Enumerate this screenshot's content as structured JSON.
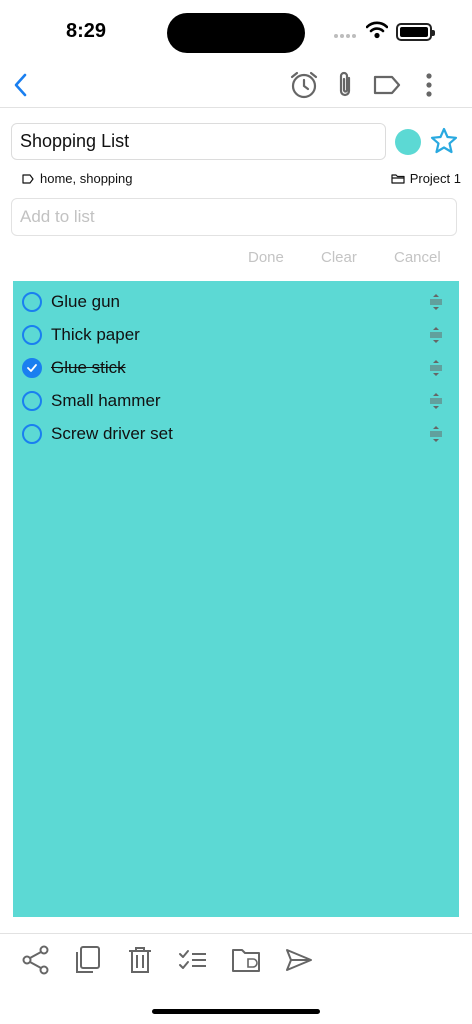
{
  "status_bar": {
    "time": "8:29"
  },
  "nav": {
    "back_icon": "chevron-left-icon",
    "actions": [
      "alarm-icon",
      "paperclip-icon",
      "tag-icon",
      "more-vertical-icon"
    ],
    "accent_color": "#1a7ff0"
  },
  "note": {
    "title": "Shopping List",
    "color": "#5cd9d4",
    "favorite": false,
    "tags": "home, shopping",
    "project": "Project 1"
  },
  "add_item": {
    "placeholder": "Add to list"
  },
  "actions": {
    "done": "Done",
    "clear": "Clear",
    "cancel": "Cancel"
  },
  "items": [
    {
      "label": "Glue gun",
      "checked": false
    },
    {
      "label": "Thick paper",
      "checked": false
    },
    {
      "label": "Glue stick",
      "checked": true
    },
    {
      "label": "Small hammer",
      "checked": false
    },
    {
      "label": "Screw driver set",
      "checked": false
    }
  ],
  "toolbar": [
    "share-icon",
    "copy-icon",
    "trash-icon",
    "checklist-icon",
    "folder-icon",
    "send-icon"
  ]
}
